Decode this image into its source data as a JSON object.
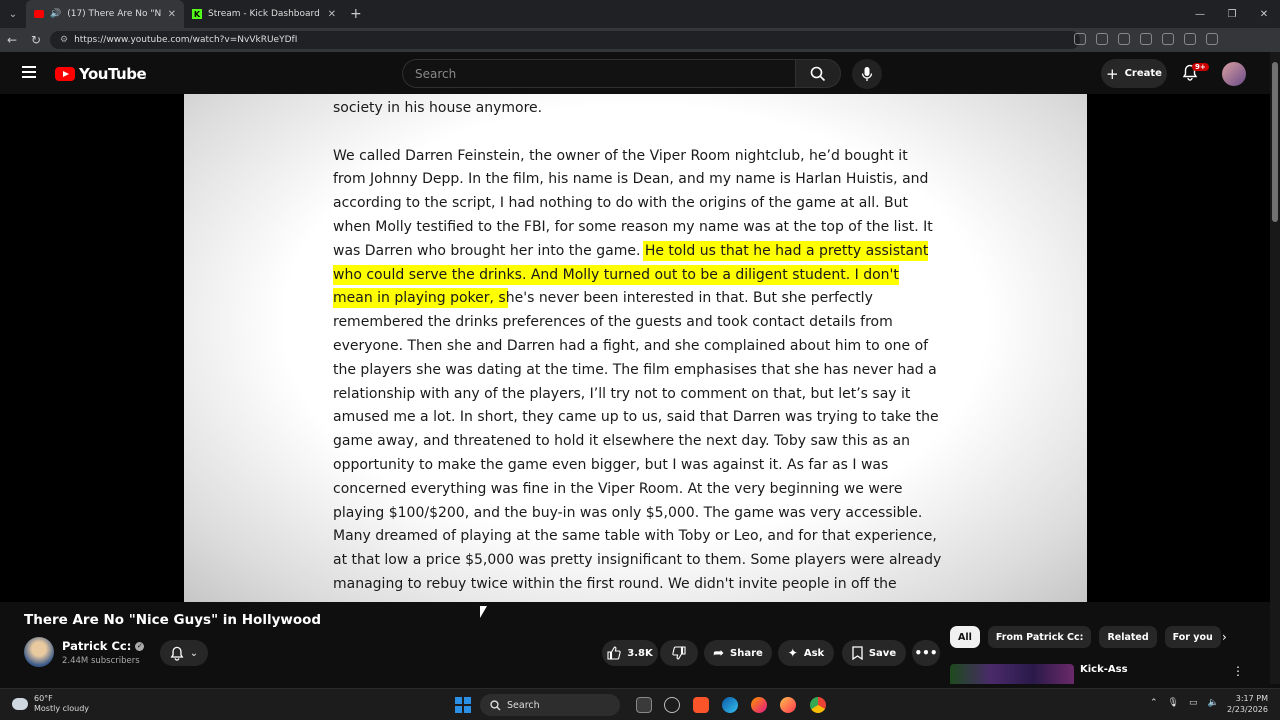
{
  "browser": {
    "tabs": [
      {
        "title": "(17) There Are No \"Nice Guys\"",
        "active": true
      },
      {
        "title": "Stream - Kick Dashboard",
        "active": false
      }
    ],
    "url": "https://www.youtube.com/watch?v=NvVkRUeYDfI"
  },
  "header": {
    "logo_text": "YouTube",
    "search_placeholder": "Search",
    "create_label": "Create",
    "notification_count": "9+"
  },
  "document": {
    "line0": "society in his house anymore.",
    "para_before_highlight": "We called Darren Feinstein, the owner of the Viper Room nightclub, he’d bought it from Johnny Depp. In the film, his name is Dean, and my name is Harlan Huistis, and according to the script, I had nothing to do with the origins of the game at all. But when Molly testified to the FBI, for some reason my name was at the top of the list. It was Darren who brought her into the game. ",
    "highlight": "He told us that he had a pretty assistant who could serve the drinks. And Molly turned out to be a diligent student. I don't mean in playing poker, s",
    "para_after_highlight": "he's never been interested in that. But she perfectly remembered the drinks preferences of the guests and took contact details from everyone. Then she and Darren had a fight, and she complained about him to one of the players she was dating at the time. The film emphasises that she has never had a relationship with any of the players, I’ll try not to comment on that, but let’s say it amused me a lot. In short, they came up to us, said that Darren was trying to take the game away, and threatened to hold it elsewhere the next day. Toby saw this as an opportunity to make the game even bigger, but I was against it. As far as I was concerned everything was fine in the Viper Room. At the very beginning we were playing $100/$200, and the buy-in was only $5,000. The game was very accessible. Many dreamed of playing at the same table with Toby or Leo, and for that experience, at that low a price $5,000 was pretty insignificant to them. Some players were already managing to rebuy twice within the first round. We didn't invite people in off the"
  },
  "video": {
    "title": "There Are No \"Nice Guys\" in Hollywood",
    "channel_name": "Patrick Cc:",
    "subscribers": "2.44M subscribers",
    "like_count": "3.8K",
    "share_label": "Share",
    "ask_label": "Ask",
    "save_label": "Save"
  },
  "recommendations": {
    "chips": [
      "All",
      "From Patrick Cc:",
      "Related",
      "For you"
    ],
    "first_item_title": "Kick-Ass"
  },
  "taskbar": {
    "temperature": "60°F",
    "weather_desc": "Mostly cloudy",
    "search_label": "Search",
    "time": "3:17 PM",
    "date": "2/23/2026"
  },
  "colors": {
    "highlight": "#ffff00",
    "youtube_red": "#ff0000",
    "kick_green": "#53fc18",
    "page_bg": "#0f0f0f"
  }
}
